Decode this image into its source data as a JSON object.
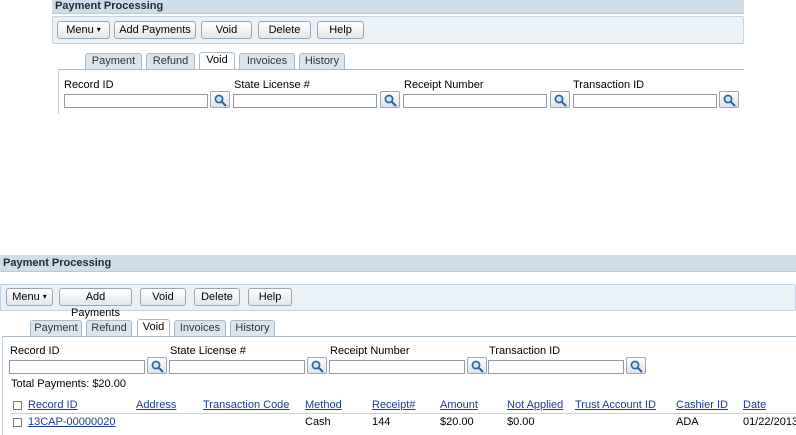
{
  "title": "Payment Processing",
  "toolbar": {
    "menu_label": "Menu",
    "menu_caret": "▾",
    "add_payments_label": "Add Payments",
    "void_label": "Void",
    "delete_label": "Delete",
    "help_label": "Help"
  },
  "tabs": [
    "Payment",
    "Refund",
    "Void",
    "Invoices",
    "History"
  ],
  "active_tab": "Void",
  "fields": {
    "record_id_label": "Record ID",
    "record_id_value": "",
    "state_license_label": "State License #",
    "state_license_value": "",
    "receipt_number_label": "Receipt Number",
    "receipt_number_value": "",
    "transaction_id_label": "Transaction ID",
    "transaction_id_value": ""
  },
  "total_payments": "Total Payments:  $20.00",
  "table": {
    "headers": [
      "Record ID",
      "Address",
      "Transaction Code",
      "Method",
      "Receipt#",
      "Amount",
      "Not Applied",
      "Trust Account ID",
      "Cashier ID",
      "Date"
    ],
    "rows": [
      [
        "13CAP-00000020",
        "",
        "",
        "Cash",
        "144",
        "$20.00",
        "$0.00",
        "",
        "ADA",
        "01/22/2013"
      ]
    ]
  },
  "icons": {
    "search": "search-icon",
    "checkbox": "checkbox"
  },
  "colors": {
    "titlebar": "#cfdde9",
    "toolbar": "#eaf1f7",
    "link": "#1a3d8c",
    "tab_inactive": "#dae5ee"
  }
}
